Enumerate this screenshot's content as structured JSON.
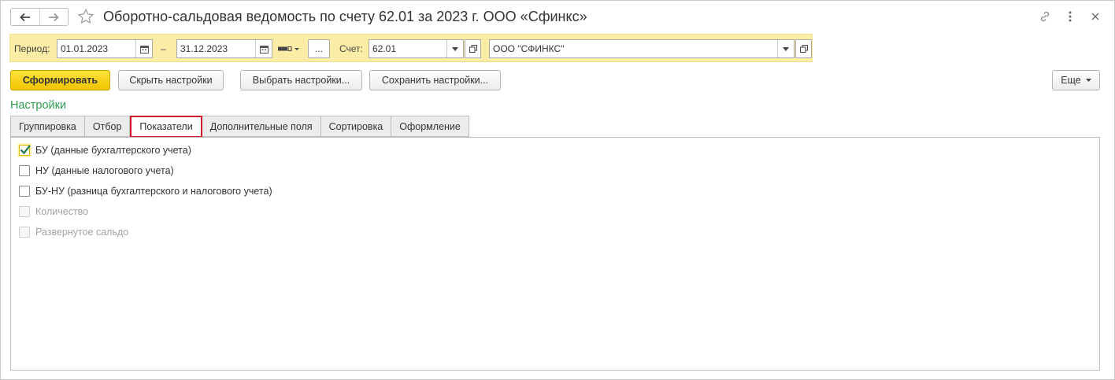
{
  "window": {
    "title": "Оборотно-сальдовая ведомость по счету 62.01 за 2023 г. ООО «Сфинкс»"
  },
  "params": {
    "period_label": "Период:",
    "date_from": "01.01.2023",
    "date_separator": "–",
    "date_to": "31.12.2023",
    "ellipsis_label": "...",
    "account_label": "Счет:",
    "account_value": "62.01",
    "organization_value": "ООО \"СФИНКС\""
  },
  "commands": {
    "generate": "Сформировать",
    "hide_settings": "Скрыть настройки",
    "choose_settings": "Выбрать настройки...",
    "save_settings": "Сохранить настройки...",
    "more": "Еще"
  },
  "settings": {
    "title": "Настройки",
    "tabs": [
      {
        "label": "Группировка",
        "active": false
      },
      {
        "label": "Отбор",
        "active": false
      },
      {
        "label": "Показатели",
        "active": true
      },
      {
        "label": "Дополнительные поля",
        "active": false
      },
      {
        "label": "Сортировка",
        "active": false
      },
      {
        "label": "Оформление",
        "active": false
      }
    ],
    "indicators": [
      {
        "label": "БУ (данные бухгалтерского учета)",
        "checked": true,
        "enabled": true
      },
      {
        "label": "НУ (данные налогового учета)",
        "checked": false,
        "enabled": true
      },
      {
        "label": "БУ-НУ (разница бухгалтерского и налогового учета)",
        "checked": false,
        "enabled": true
      },
      {
        "label": "Количество",
        "checked": false,
        "enabled": false
      },
      {
        "label": "Развернутое сальдо",
        "checked": false,
        "enabled": false
      }
    ]
  },
  "colors": {
    "params_background": "#fbeda6",
    "primary_button": "#f1c400",
    "section_title": "#2e9e4f",
    "active_tab_border": "#d3162b",
    "checkmark": "#2e7d5b"
  },
  "icons": [
    "back-arrow-icon",
    "forward-arrow-icon",
    "star-icon",
    "link-icon",
    "more-vertical-icon",
    "close-icon",
    "calendar-icon",
    "period-selector-icon",
    "dropdown-arrow-icon",
    "open-icon",
    "checkmark-icon"
  ]
}
